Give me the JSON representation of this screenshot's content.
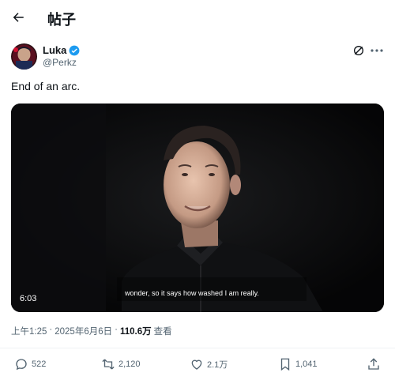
{
  "header": {
    "title": "帖子"
  },
  "author": {
    "name": "Luka",
    "handle": "@Perkz"
  },
  "tweet": {
    "text": "End of an arc."
  },
  "media": {
    "duration": "6:03",
    "subtitle": "wonder, so it says how washed I am really."
  },
  "meta": {
    "time": "上午1:25",
    "sep1": "·",
    "date": "2025年6月6日",
    "sep2": "·",
    "views": "110.6万",
    "views_label": "查看"
  },
  "actions": {
    "replies": "522",
    "reposts": "2,120",
    "likes": "2.1万",
    "bookmarks": "1,041"
  },
  "colors": {
    "verified": "#1d9bf0",
    "text": "#0f1419",
    "secondary": "#536471"
  },
  "icons": [
    "back-arrow-icon",
    "verified-badge-icon",
    "grok-icon",
    "more-icon",
    "reply-icon",
    "repost-icon",
    "like-icon",
    "bookmark-icon",
    "share-icon"
  ]
}
